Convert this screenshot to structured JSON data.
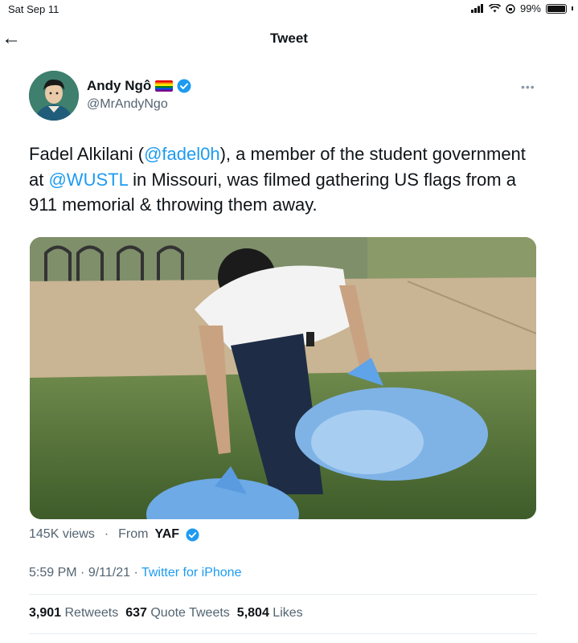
{
  "status_bar": {
    "date": "Sat Sep 11",
    "battery": "99%"
  },
  "header": {
    "title": "Tweet"
  },
  "tweet": {
    "author_name": "Andy Ngô",
    "author_handle": "@MrAndyNgo",
    "text_parts": {
      "p1": "Fadel Alkilani (",
      "mention1": "@fadel0h",
      "p2": "), a member of the student government at ",
      "mention2": "@WUSTL",
      "p3": " in Missouri, was filmed gathering US flags from a 911 memorial & throwing them away."
    },
    "views": "145K views",
    "dot": "·",
    "from_label": "From",
    "from_name": "YAF",
    "time": "5:59 PM",
    "date": "9/11/21",
    "source": "Twitter for iPhone"
  },
  "stats": {
    "retweets_count": "3,901",
    "retweets_label": "Retweets",
    "quotes_count": "637",
    "quotes_label": "Quote Tweets",
    "likes_count": "5,804",
    "likes_label": "Likes"
  },
  "colors": {
    "accent": "#1d9bf0",
    "secondary_text": "#536471"
  }
}
